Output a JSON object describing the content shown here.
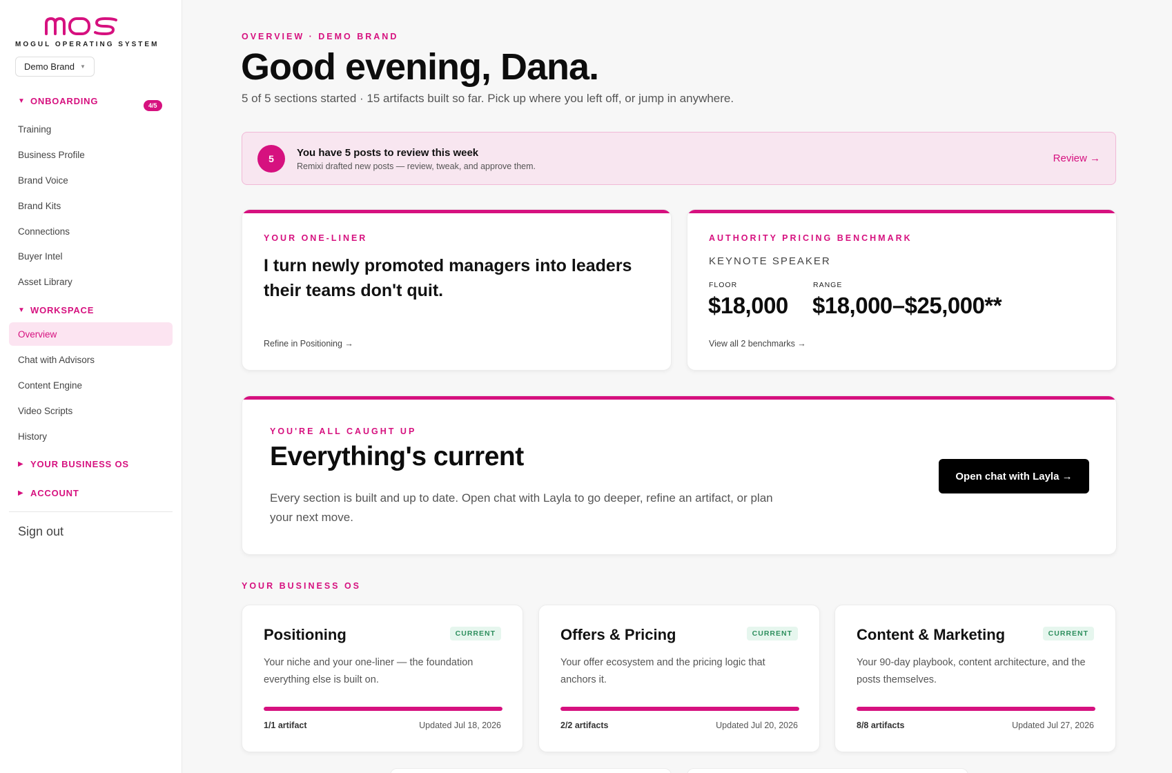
{
  "sidebar": {
    "logo_text": "MOS",
    "logo_sub": "MOGUL OPERATING SYSTEM",
    "brand_select": "Demo Brand",
    "sections": {
      "onboarding": {
        "label": "ONBOARDING",
        "badge": "4/5"
      },
      "workspace": {
        "label": "WORKSPACE"
      },
      "business_os": {
        "label": "YOUR BUSINESS OS"
      },
      "account": {
        "label": "ACCOUNT"
      }
    },
    "onboarding_items": [
      "Training",
      "Business Profile",
      "Brand Voice",
      "Brand Kits",
      "Connections",
      "Buyer Intel",
      "Asset Library"
    ],
    "workspace_items": [
      "Overview",
      "Chat with Advisors",
      "Content Engine",
      "Video Scripts",
      "History"
    ],
    "active_item": "Overview",
    "sign_out": "Sign out"
  },
  "header": {
    "eyebrow": "OVERVIEW · DEMO BRAND",
    "title": "Good evening, Dana.",
    "subtitle": "5 of 5 sections started · 15 artifacts built so far. Pick up where you left off, or jump in anywhere."
  },
  "banner": {
    "count": "5",
    "title": "You have 5 posts to review this week",
    "subtitle": "Remixi drafted new posts — review, tweak, and approve them.",
    "link": "Review →"
  },
  "oneliner": {
    "eyebrow": "YOUR ONE-LINER",
    "text": "I turn newly promoted managers into leaders their teams don't quit.",
    "link": "Refine in Positioning →"
  },
  "pricing": {
    "eyebrow": "AUTHORITY PRICING BENCHMARK",
    "role": "KEYNOTE SPEAKER",
    "floor_label": "FLOOR",
    "floor_value": "$18,000",
    "range_label": "RANGE",
    "range_value": "$18,000–$25,000**",
    "link": "View all 2 benchmarks →"
  },
  "caught_up": {
    "eyebrow": "YOU'RE ALL CAUGHT UP",
    "title": "Everything's current",
    "body": "Every section is built and up to date. Open chat with Layla to go deeper, refine an artifact, or plan your next move.",
    "button": "Open chat with Layla →"
  },
  "business_os": {
    "eyebrow": "YOUR BUSINESS OS",
    "cards": [
      {
        "title": "Positioning",
        "status": "CURRENT",
        "desc": "Your niche and your one-liner — the foundation everything else is built on.",
        "progress": 1.0,
        "count": "1/1 artifact",
        "updated": "Updated Jul 18, 2026"
      },
      {
        "title": "Offers & Pricing",
        "status": "CURRENT",
        "desc": "Your offer ecosystem and the pricing logic that anchors it.",
        "progress": 1.0,
        "count": "2/2 artifacts",
        "updated": "Updated Jul 20, 2026"
      },
      {
        "title": "Content & Marketing",
        "status": "CURRENT",
        "desc": "Your 90-day playbook, content architecture, and the posts themselves.",
        "progress": 1.0,
        "count": "8/8 artifacts",
        "updated": "Updated Jul 27, 2026"
      }
    ]
  },
  "colors": {
    "accent": "#d6117f",
    "accent_soft": "#fce4f1",
    "status_green": "#2e8f5e"
  },
  "icons": {
    "section_open": "triangle-down-icon",
    "section_closed": "triangle-right-icon",
    "select_caret": "chevron-down-icon"
  }
}
